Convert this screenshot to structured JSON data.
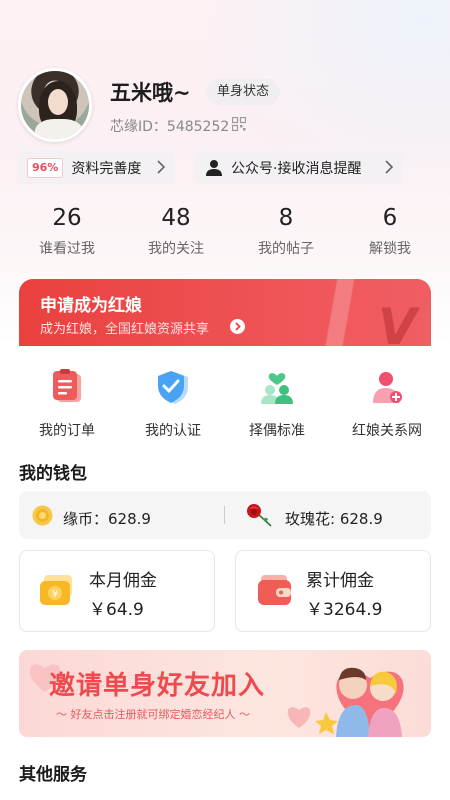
{
  "profile": {
    "nickname": "五米哦~",
    "status_badge": "单身状态",
    "uid_label": "芯缘ID：5485252"
  },
  "pills": {
    "completeness_pct": "96%",
    "completeness_label": "资料完善度",
    "notify_label": "公众号·接收消息提醒"
  },
  "stats": [
    {
      "value": "26",
      "label": "谁看过我"
    },
    {
      "value": "48",
      "label": "我的关注"
    },
    {
      "value": "8",
      "label": "我的帖子"
    },
    {
      "value": "6",
      "label": "解锁我"
    }
  ],
  "matchmaker": {
    "title": "申请成为红娘",
    "subtitle": "成为红娘，全国红娘资源共享"
  },
  "shortcuts": [
    {
      "label": "我的订单",
      "icon": "order-icon"
    },
    {
      "label": "我的认证",
      "icon": "verify-shield-icon"
    },
    {
      "label": "择偶标准",
      "icon": "partner-standard-icon"
    },
    {
      "label": "红娘关系网",
      "icon": "matchmaker-network-icon"
    }
  ],
  "wallet": {
    "title": "我的钱包",
    "coin_label": "缘币：628.9",
    "rose_label": "玫瑰花: 628.9",
    "month_title": "本月佣金",
    "month_value": "￥64.9",
    "total_title": "累计佣金",
    "total_value": "￥3264.9"
  },
  "invite": {
    "title": "邀请单身好友加入",
    "subtitle": "～ 好友点击注册就可绑定婚恋经纪人 ～"
  },
  "other": {
    "title": "其他服务"
  },
  "colors": {
    "accent_red": "#ef4a4f",
    "banner_red": "#e9413e"
  }
}
